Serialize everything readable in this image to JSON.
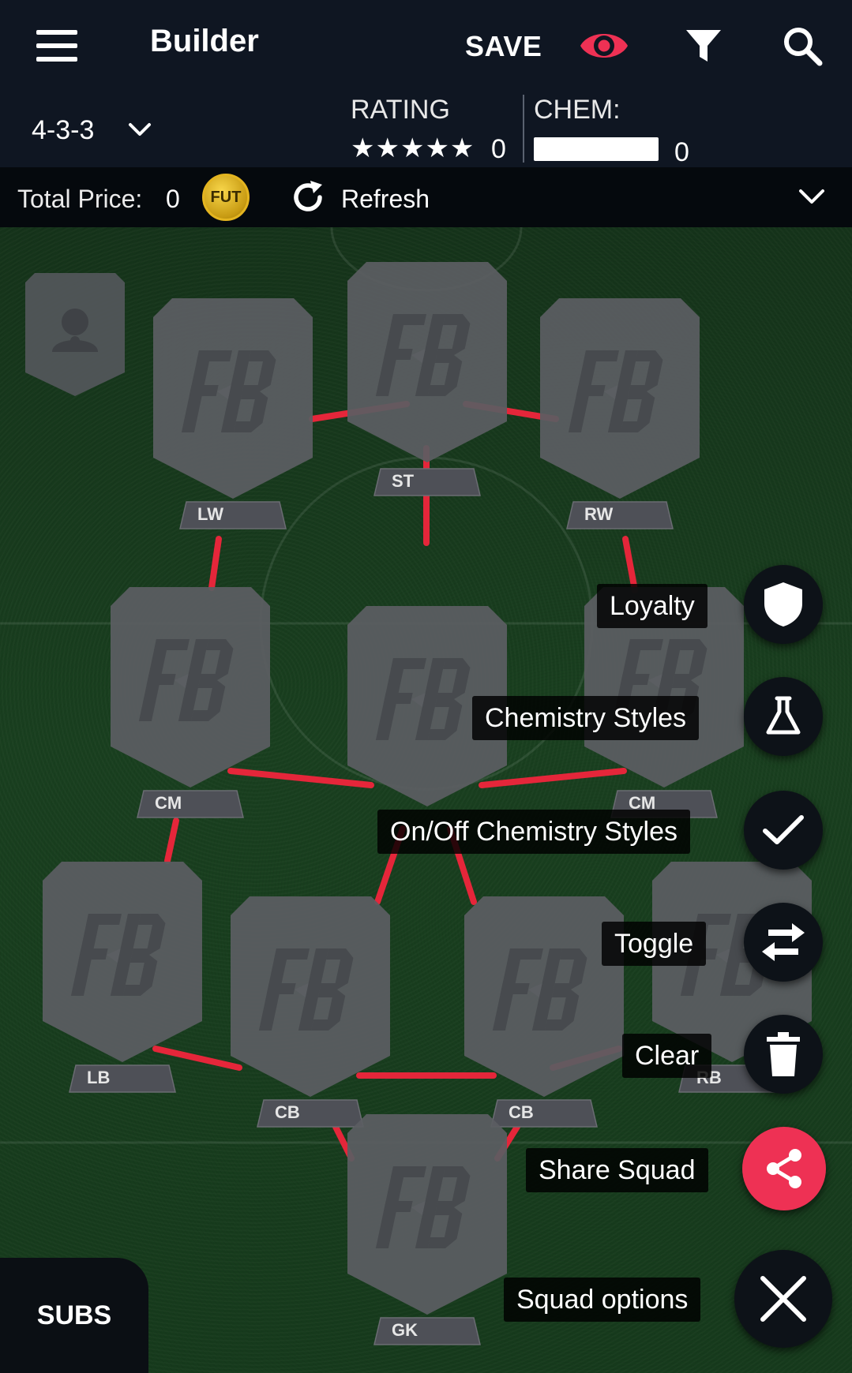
{
  "header": {
    "title": "Builder",
    "save_label": "SAVE",
    "icons": [
      "menu-icon",
      "eye-icon",
      "filter-icon",
      "search-icon"
    ]
  },
  "squad_stats": {
    "formation": "4-3-3",
    "rating_label": "RATING",
    "stars": "★★★★★",
    "rating_value": "0",
    "chem_label": "CHEM:",
    "chem_value": "0"
  },
  "price_bar": {
    "total_label": "Total Price:",
    "total_value": "0",
    "coin_label": "FUT",
    "refresh_label": "Refresh"
  },
  "positions": {
    "st": "ST",
    "lw": "LW",
    "rw": "RW",
    "lcm": "CM",
    "rcm": "CM",
    "lb": "LB",
    "lcb": "CB",
    "rcb": "CB",
    "rb": "RB",
    "gk": "GK"
  },
  "speed_dial": {
    "loyalty": "Loyalty",
    "chemistry_styles": "Chemistry Styles",
    "on_off_chemistry_styles": "On/Off Chemistry Styles",
    "toggle": "Toggle",
    "clear": "Clear",
    "share_squad": "Share Squad",
    "squad_options": "Squad options"
  },
  "subs_label": "SUBS",
  "colors": {
    "accent_red": "#ee3154",
    "link_red": "#e5263a",
    "header_bg": "#0f1622",
    "pitch_green": "#173a1d",
    "card_grey": "#5b5e62",
    "coin_gold": "#e4b520"
  }
}
